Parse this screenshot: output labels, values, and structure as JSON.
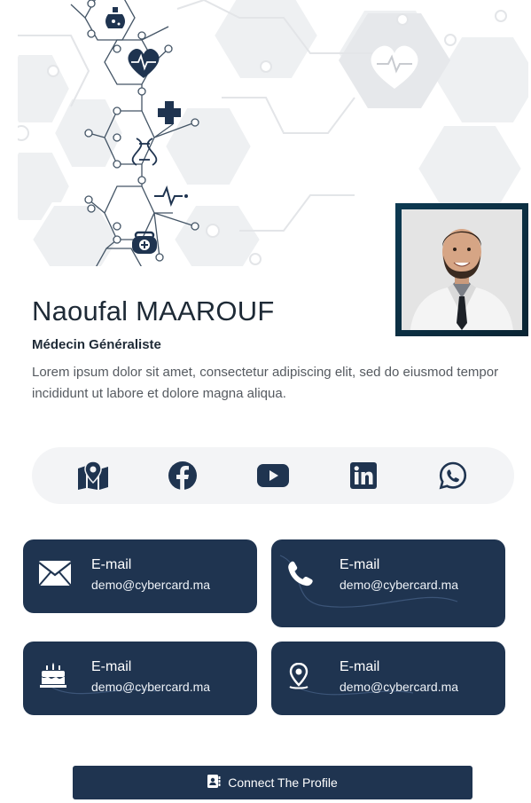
{
  "profile": {
    "name": "Naoufal MAAROUF",
    "title": "Médecin Généraliste",
    "bio": "Lorem ipsum dolor sit amet, consectetur adipiscing elit, sed do eiusmod tempor incididunt ut labore et dolore magna aliqua."
  },
  "social": [
    {
      "icon": "map-icon"
    },
    {
      "icon": "facebook-icon"
    },
    {
      "icon": "youtube-icon"
    },
    {
      "icon": "linkedin-icon"
    },
    {
      "icon": "whatsapp-icon"
    }
  ],
  "cards": [
    {
      "icon": "envelope-icon",
      "label": "E-mail",
      "value": "demo@cybercard.ma"
    },
    {
      "icon": "phone-icon",
      "label": "E-mail",
      "value": "demo@cybercard.ma"
    },
    {
      "icon": "birthday-cake-icon",
      "label": "E-mail",
      "value": "demo@cybercard.ma"
    },
    {
      "icon": "location-pin-icon",
      "label": "E-mail",
      "value": "demo@cybercard.ma"
    }
  ],
  "connect": {
    "label": "Connect The Profile",
    "icon": "contact-card-icon"
  },
  "colors": {
    "primary": "#1f3450",
    "social_bg": "#f3f4f6",
    "text_dark": "#1e2a36",
    "text_muted": "#555a60"
  }
}
